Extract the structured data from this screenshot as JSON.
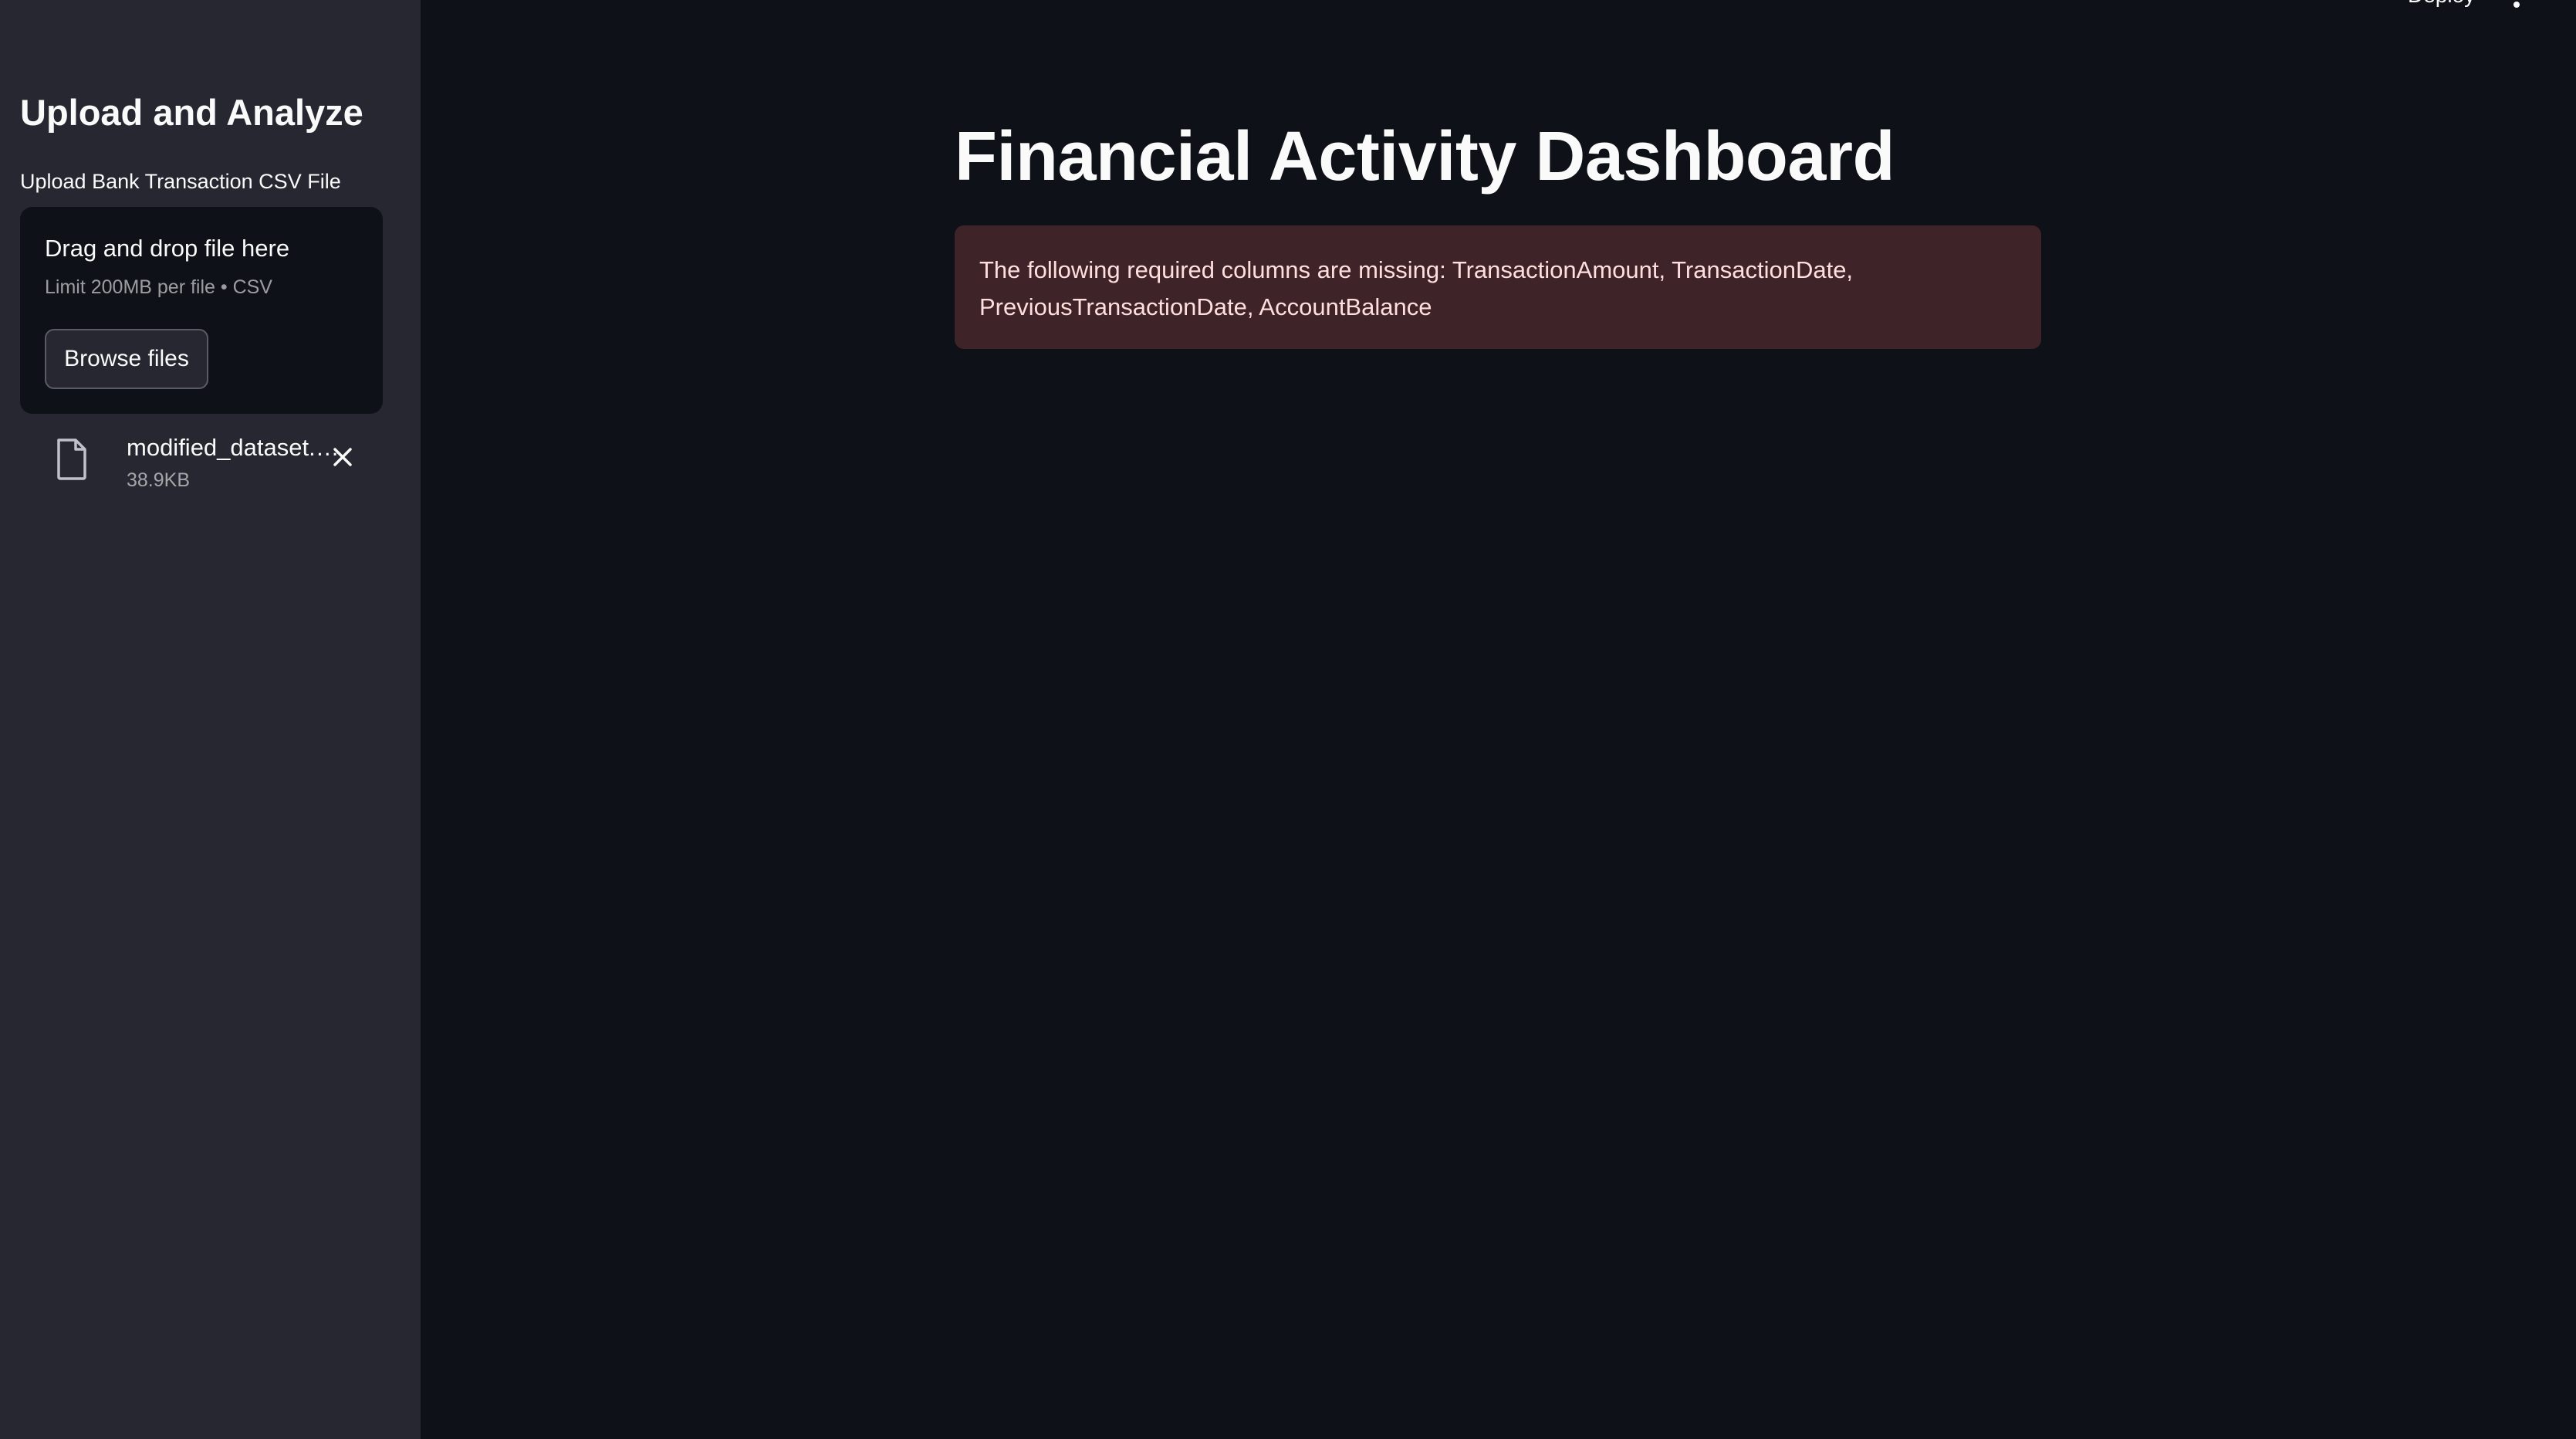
{
  "sidebar": {
    "title": "Upload and Analyze",
    "uploader": {
      "label": "Upload Bank Transaction CSV File",
      "drop_title": "Drag and drop file here",
      "drop_sub": "Limit 200MB per file • CSV",
      "browse_label": "Browse files"
    },
    "file": {
      "name": "modified_dataset.csv",
      "size": "38.9KB",
      "icon": "file-icon"
    }
  },
  "header": {
    "deploy_label": "Deploy",
    "menu_icon": "more-vertical-icon"
  },
  "main": {
    "title": "Financial Activity Dashboard",
    "error": "The following required columns are missing: TransactionAmount, TransactionDate, PreviousTransactionDate, AccountBalance"
  },
  "colors": {
    "background": "#0e1117",
    "sidebar": "#262730",
    "error_bg": "#3e2428",
    "error_text": "#ffdede"
  }
}
